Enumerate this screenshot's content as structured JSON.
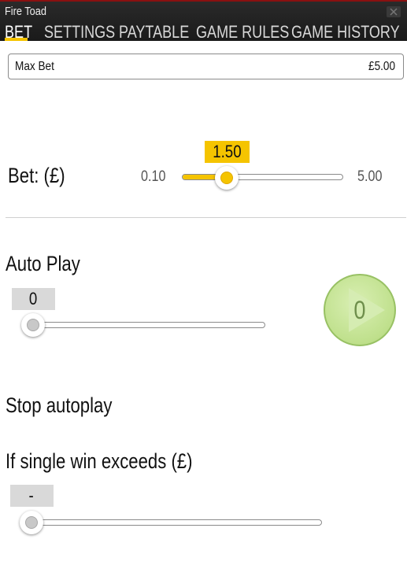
{
  "app": {
    "title": "Fire Toad"
  },
  "tabs": [
    {
      "label": "BET",
      "active": true
    },
    {
      "label": "SETTINGS",
      "active": false
    },
    {
      "label": "PAYTABLE",
      "active": false
    },
    {
      "label": "GAME RULES",
      "active": false
    },
    {
      "label": "GAME HISTORY",
      "active": false
    }
  ],
  "max_bet": {
    "label": "Max Bet",
    "value": "£5.00"
  },
  "bet": {
    "label": "Bet: (£)",
    "min": "0.10",
    "max": "5.00",
    "value": "1.50",
    "fraction": 0.28
  },
  "auto_play": {
    "heading": "Auto Play",
    "value": "0",
    "fraction": 0,
    "button_count": "0"
  },
  "stop_autoplay": {
    "heading": "Stop autoplay"
  },
  "single_win": {
    "heading": "If single win exceeds (£)",
    "value": "-",
    "fraction": 0
  },
  "colors": {
    "accent": "#f5c400",
    "play_button": "#bfe08c",
    "badge_grey": "#d9d9d9"
  },
  "icons": {
    "close": "close-icon",
    "play": "play-icon"
  }
}
